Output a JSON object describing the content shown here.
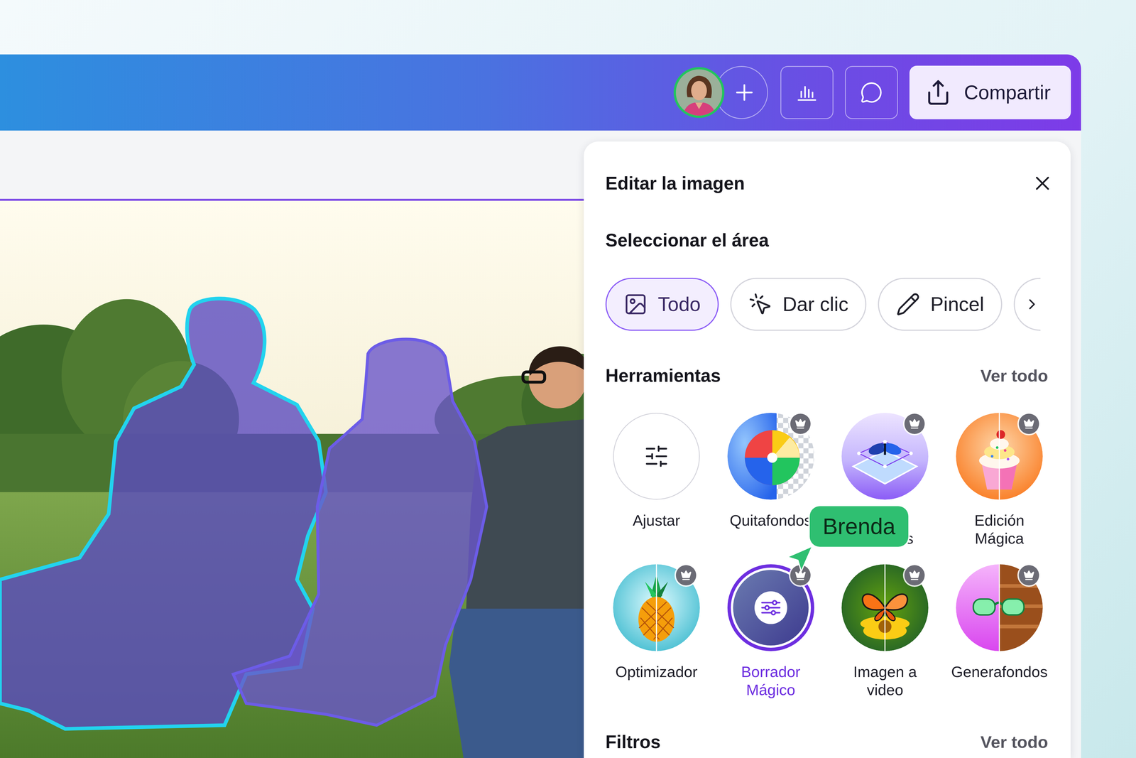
{
  "toolbar": {
    "collaborator_avatar": {
      "online": true
    },
    "share_button": {
      "label": "Compartir"
    }
  },
  "panel": {
    "title": "Editar la imagen",
    "selection": {
      "heading": "Seleccionar el área",
      "modes": [
        {
          "label": "Todo",
          "selected": true
        },
        {
          "label": "Dar clic",
          "selected": false
        },
        {
          "label": "Pincel",
          "selected": false
        }
      ]
    },
    "tools": {
      "heading": "Herramientas",
      "see_all": "Ver todo",
      "items": [
        {
          "label": "Ajustar",
          "premium": false,
          "selected": false
        },
        {
          "label": "Quitafondos",
          "premium": true,
          "selected": false
        },
        {
          "label": "Capas Mágicas",
          "premium": true,
          "selected": false
        },
        {
          "label": "Edición Mágica",
          "premium": true,
          "selected": false
        },
        {
          "label": "Optimizador",
          "premium": true,
          "selected": false
        },
        {
          "label": "Borrador Mágico",
          "premium": true,
          "selected": true
        },
        {
          "label": "Imagen a video",
          "premium": true,
          "selected": false
        },
        {
          "label": "Generafondos",
          "premium": true,
          "selected": false
        }
      ]
    },
    "filters": {
      "heading": "Filtros",
      "see_all": "Ver todo"
    }
  },
  "collaborator_cursor": {
    "name": "Brenda"
  }
}
